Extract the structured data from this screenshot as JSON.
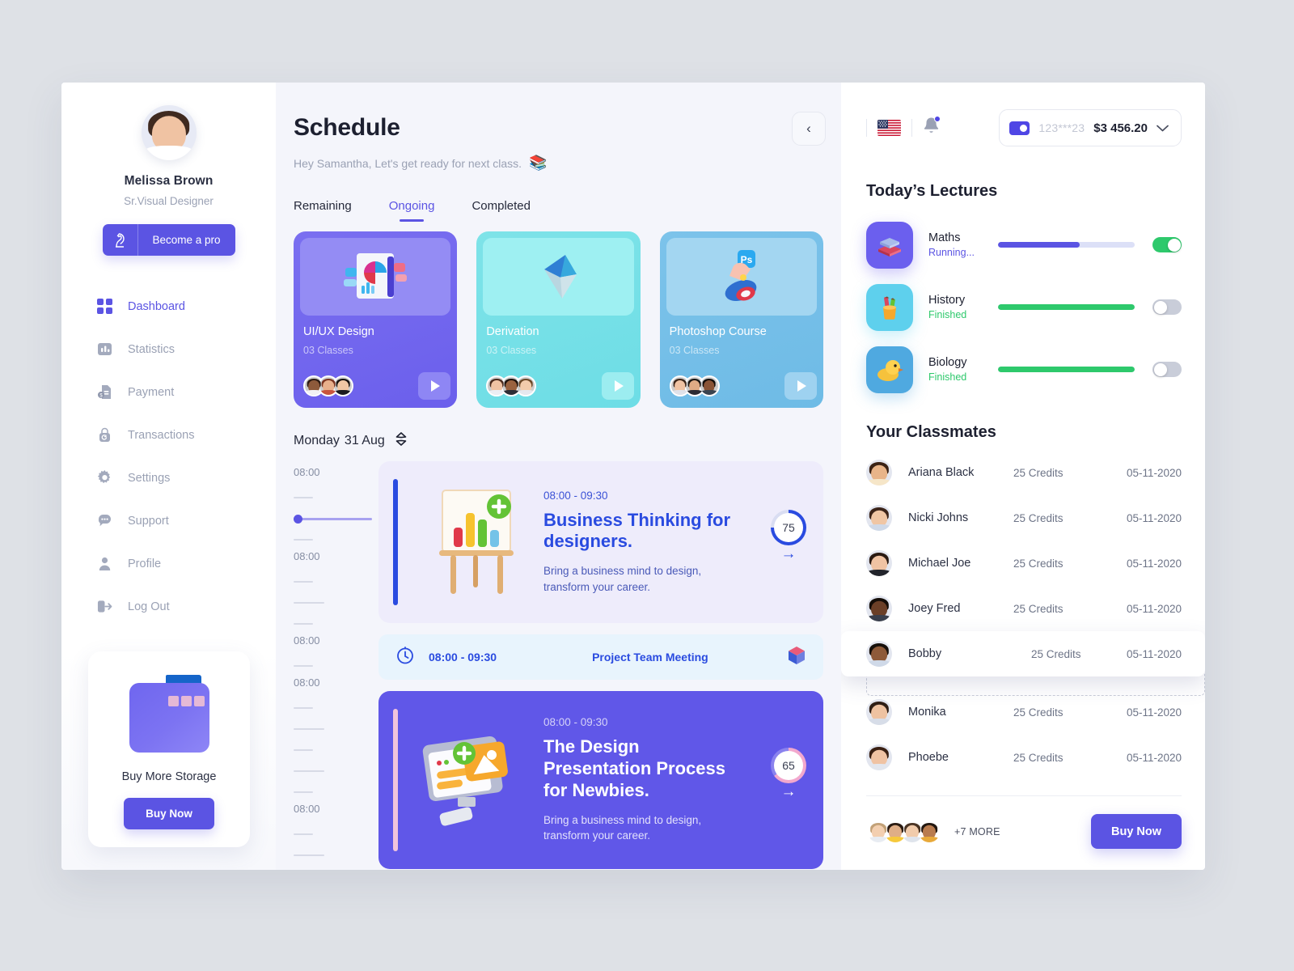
{
  "sidebar": {
    "profile": {
      "name": "Melissa Brown",
      "role": "Sr.Visual Designer"
    },
    "pro_button": {
      "label": "Become a pro",
      "icon": "chess-knight-icon"
    },
    "nav": [
      {
        "label": "Dashboard",
        "icon": "grid-icon",
        "active": true
      },
      {
        "label": "Statistics",
        "icon": "bar-chart-icon",
        "active": false
      },
      {
        "label": "Payment",
        "icon": "invoice-icon",
        "active": false
      },
      {
        "label": "Transactions",
        "icon": "lock-refresh-icon",
        "active": false
      },
      {
        "label": "Settings",
        "icon": "gear-icon",
        "active": false
      },
      {
        "label": "Support",
        "icon": "chat-bubble-icon",
        "active": false
      },
      {
        "label": "Profile",
        "icon": "user-icon",
        "active": false
      },
      {
        "label": "Log Out",
        "icon": "logout-icon",
        "active": false
      }
    ],
    "storage": {
      "title": "Buy More Storage",
      "button": "Buy Now",
      "icon": "folder-icon"
    }
  },
  "center": {
    "title": "Schedule",
    "subtitle": "Hey Samantha, Let's get ready for next class.",
    "subtitle_emoji": "books-icon",
    "back_button": "‹",
    "tabs": [
      {
        "label": "Remaining",
        "active": false
      },
      {
        "label": "Ongoing",
        "active": true
      },
      {
        "label": "Completed",
        "active": false
      }
    ],
    "courses": [
      {
        "title": "UI/UX Design",
        "classes": "03 Classes",
        "art": "analytics-chart-icon",
        "theme": "cc-1"
      },
      {
        "title": "Derivation",
        "classes": "03 Classes",
        "art": "vector-arrow-icon",
        "theme": "cc-2"
      },
      {
        "title": "Photoshop Course",
        "classes": "03 Classes",
        "art": "photoshop-hand-icon",
        "theme": "cc-3"
      }
    ],
    "day": {
      "weekday": "Monday",
      "date": "31 Aug",
      "selector_icon": "sort-updown-icon"
    },
    "ticks": [
      "08:00",
      "08:00",
      "08:00",
      "08:00",
      "08:00"
    ],
    "events": [
      {
        "time": "08:00 - 09:30",
        "title": "Business Thinking for designers.",
        "desc": "Bring a business mind to design, transform your career.",
        "progress": "75",
        "art": "easel-bar-chart-icon",
        "arrow": "→"
      },
      {
        "time": "08:00 - 09:30",
        "title": "The Design Presentation Process for Newbies.",
        "desc": "Bring a business mind to design, transform your career.",
        "progress": "65",
        "art": "monitor-image-icon",
        "arrow": "→"
      }
    ],
    "meeting": {
      "time": "08:00 - 09:30",
      "title": "Project Team Meeting",
      "clock_icon": "clock-icon",
      "app_icon": "cube-app-icon"
    }
  },
  "right": {
    "header": {
      "flag": "us-flag-icon",
      "bell": "bell-icon",
      "card_icon": "credit-card-icon",
      "card_number": "123***23",
      "balance": "$3 456.20",
      "chevron": "⌄"
    },
    "lectures_title": "Today’s Lectures",
    "lectures": [
      {
        "name": "Maths",
        "status": "Running...",
        "status_type": "running",
        "progress": 60,
        "toggle": "on",
        "icon": "books-stack-icon",
        "icon_bg": "#6b5fee",
        "bar_color": "#5b54e3",
        "emoji": "📚"
      },
      {
        "name": "History",
        "status": "Finished",
        "status_type": "finished",
        "progress": 100,
        "toggle": "off",
        "icon": "pencil-cup-icon",
        "icon_bg": "#5ed0ed",
        "bar_color": "#2ec96c",
        "emoji": "🖍"
      },
      {
        "name": "Biology",
        "status": "Finished",
        "status_type": "finished",
        "progress": 100,
        "toggle": "off",
        "icon": "duck-icon",
        "icon_bg": "#4fa9e0",
        "bar_color": "#2ec96c",
        "emoji": "🐥"
      }
    ],
    "classmates_title": "Your Classmates",
    "classmates": [
      {
        "name": "Ariana Black",
        "credits": "25 Credits",
        "date": "05-11-2020",
        "dragging": false
      },
      {
        "name": "Nicki Johns",
        "credits": "25 Credits",
        "date": "05-11-2020",
        "dragging": false
      },
      {
        "name": "Michael Joe",
        "credits": "25 Credits",
        "date": "05-11-2020",
        "dragging": false
      },
      {
        "name": "Joey Fred",
        "credits": "25 Credits",
        "date": "05-11-2020",
        "dragging": false
      },
      {
        "name": "Bobby",
        "credits": "25 Credits",
        "date": "05-11-2020",
        "dragging": true
      },
      {
        "name": "Monika",
        "credits": "25 Credits",
        "date": "05-11-2020",
        "dragging": false
      },
      {
        "name": "Phoebe",
        "credits": "25 Credits",
        "date": "05-11-2020",
        "dragging": false
      }
    ],
    "footer": {
      "more_label": "+7 MORE",
      "buy_button": "Buy Now"
    }
  },
  "colors": {
    "accent": "#5b54e3",
    "accent_dark": "#2a4be0",
    "success": "#2ec96c",
    "page_bg": "#dee1e6",
    "center_bg": "#f4f5fb"
  }
}
